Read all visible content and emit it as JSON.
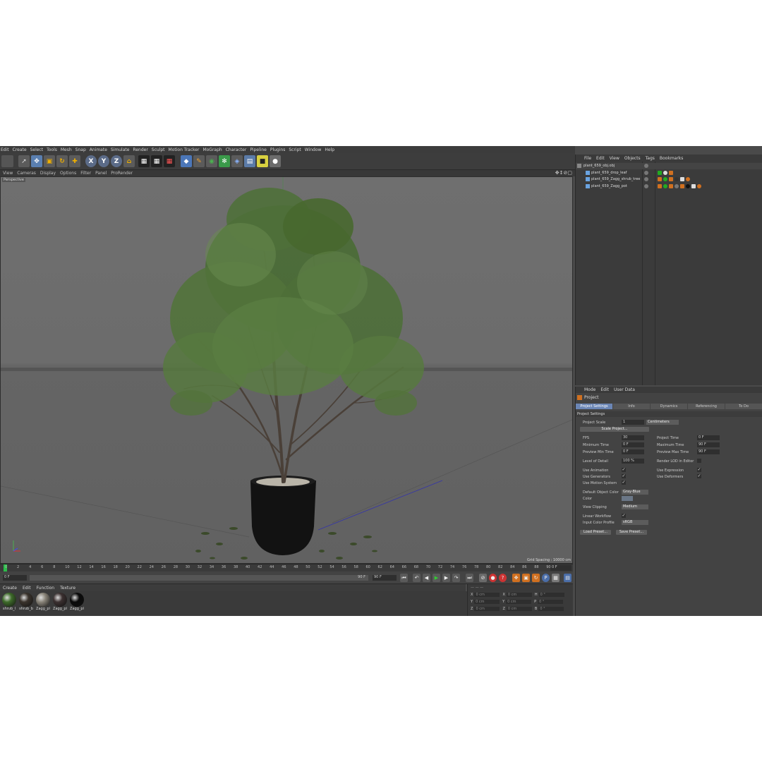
{
  "menubar": [
    "Edit",
    "Create",
    "Select",
    "Tools",
    "Mesh",
    "Snap",
    "Animate",
    "Simulate",
    "Render",
    "Sculpt",
    "Motion Tracker",
    "MoGraph",
    "Character",
    "Pipeline",
    "Plugins",
    "Script",
    "Window",
    "Help"
  ],
  "toolbar": {
    "axis_x": "X",
    "axis_y": "Y",
    "axis_z": "Z"
  },
  "viewport_menu": [
    "View",
    "Cameras",
    "Display",
    "Options",
    "Filter",
    "Panel",
    "ProRender"
  ],
  "viewport": {
    "label": "Perspective",
    "grid_spacing": "Grid Spacing : 10000 cm"
  },
  "timeline": {
    "ticks": [
      "0",
      "2",
      "4",
      "6",
      "8",
      "10",
      "12",
      "14",
      "16",
      "18",
      "20",
      "22",
      "24",
      "26",
      "28",
      "30",
      "32",
      "34",
      "36",
      "38",
      "40",
      "42",
      "44",
      "46",
      "48",
      "50",
      "52",
      "54",
      "56",
      "58",
      "60",
      "62",
      "64",
      "66",
      "68",
      "70",
      "72",
      "74",
      "76",
      "78",
      "80",
      "82",
      "84",
      "86",
      "88",
      "90"
    ],
    "current_frame": "0 F"
  },
  "transport": {
    "start_field": "0 F",
    "range_end": "90 F",
    "end_field": "90 F"
  },
  "material_menu": [
    "Create",
    "Edit",
    "Function",
    "Texture"
  ],
  "materials": [
    {
      "label": "shrub_l",
      "color": "#3e6b2a"
    },
    {
      "label": "shrub_b",
      "color": "#3a332c"
    },
    {
      "label": "Zagg_pl",
      "color": "#8a857a"
    },
    {
      "label": "Zagg_pl",
      "color": "#3b3030"
    },
    {
      "label": "Zagg_pl",
      "color": "#0a0a0a"
    }
  ],
  "coords": {
    "rows": [
      {
        "a": "X",
        "av": "0 cm",
        "b": "X",
        "bv": "0 cm",
        "c": "H",
        "cv": "0 °"
      },
      {
        "a": "Y",
        "av": "0 cm",
        "b": "Y",
        "bv": "0 cm",
        "c": "P",
        "cv": "0 °"
      },
      {
        "a": "Z",
        "av": "0 cm",
        "b": "Z",
        "bv": "0 cm",
        "c": "B",
        "cv": "0 °"
      }
    ]
  },
  "object_menu": [
    "File",
    "Edit",
    "View",
    "Objects",
    "Tags",
    "Bookmarks"
  ],
  "objects": [
    {
      "name": "plant_659_obj.obj"
    },
    {
      "name": "plant_659_drop_leaf"
    },
    {
      "name": "plant_659_Zagg_shrub_tree"
    },
    {
      "name": "plant_659_Zagg_pot"
    }
  ],
  "attr_menu": [
    "Mode",
    "Edit",
    "User Data"
  ],
  "attr": {
    "title": "Project",
    "tabs": [
      "Project Settings",
      "Info",
      "Dynamics",
      "Referencing",
      "To Do",
      "Key Interp"
    ],
    "section": "Project Settings",
    "project_scale_label": "Project Scale",
    "project_scale_value": "1",
    "project_scale_unit": "Centimeters",
    "scale_project_button": "Scale Project...",
    "fps_label": "FPS",
    "fps_value": "30",
    "project_time_label": "Project Time",
    "project_time_value": "0 F",
    "min_time_label": "Minimum Time",
    "min_time_value": "0 F",
    "max_time_label": "Maximum Time",
    "max_time_value": "90 F",
    "prev_min_label": "Preview Min Time",
    "prev_min_value": "0 F",
    "prev_max_label": "Preview Max Time",
    "prev_max_value": "90 F",
    "lod_label": "Level of Detail",
    "lod_value": "100 %",
    "render_lod_label": "Render LOD in Editor",
    "use_anim_label": "Use Animation",
    "use_expr_label": "Use Expression",
    "use_gen_label": "Use Generators",
    "use_def_label": "Use Deformers",
    "use_motion_label": "Use Motion System",
    "default_color_label": "Default Object Color",
    "default_color_value": "Gray-Blue",
    "color_label": "Color",
    "view_clipping_label": "View Clipping",
    "view_clipping_value": "Medium",
    "linear_label": "Linear Workflow",
    "input_profile_label": "Input Color Profile",
    "input_profile_value": "sRGB",
    "load_preset": "Load Preset...",
    "save_preset": "Save Preset...",
    "check": "✓"
  }
}
